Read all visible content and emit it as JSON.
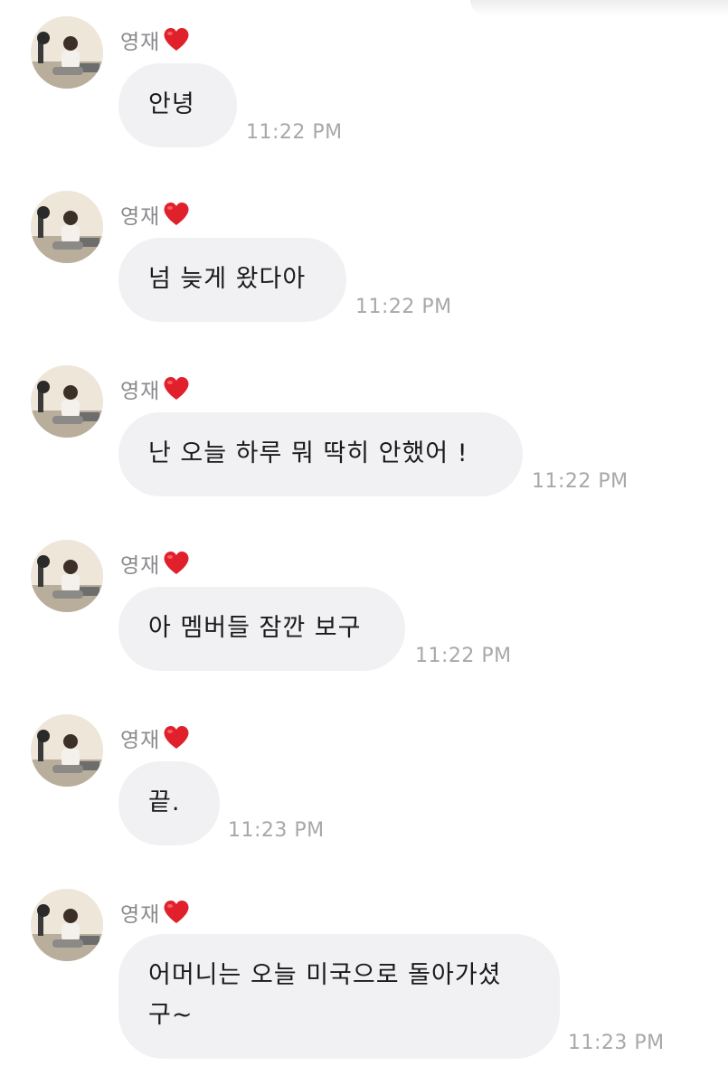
{
  "messages": [
    {
      "sender": "영재",
      "text": "안녕",
      "time": "11:22 PM"
    },
    {
      "sender": "영재",
      "text": "넘 늦게 왔다아",
      "time": "11:22 PM"
    },
    {
      "sender": "영재",
      "text": "난 오늘 하루 뭐 딱히 안했어 !",
      "time": "11:22 PM"
    },
    {
      "sender": "영재",
      "text": "아 멤버들 잠깐 보구",
      "time": "11:22 PM"
    },
    {
      "sender": "영재",
      "text": "끝.",
      "time": "11:23 PM"
    },
    {
      "sender": "영재",
      "text": "어머니는 오늘 미국으로 돌아가셨구~",
      "text_line1": "어머니는 오늘 미국으로 돌아가셨",
      "text_line2": "구~",
      "time": "11:23 PM"
    }
  ],
  "icons": {
    "sender_badge": "heart-icon",
    "avatar": "profile-photo"
  },
  "colors": {
    "bubble": "#f1f1f4",
    "heart": "#e0202a",
    "time": "#a8a8ac",
    "sender": "#8a8a8e"
  }
}
